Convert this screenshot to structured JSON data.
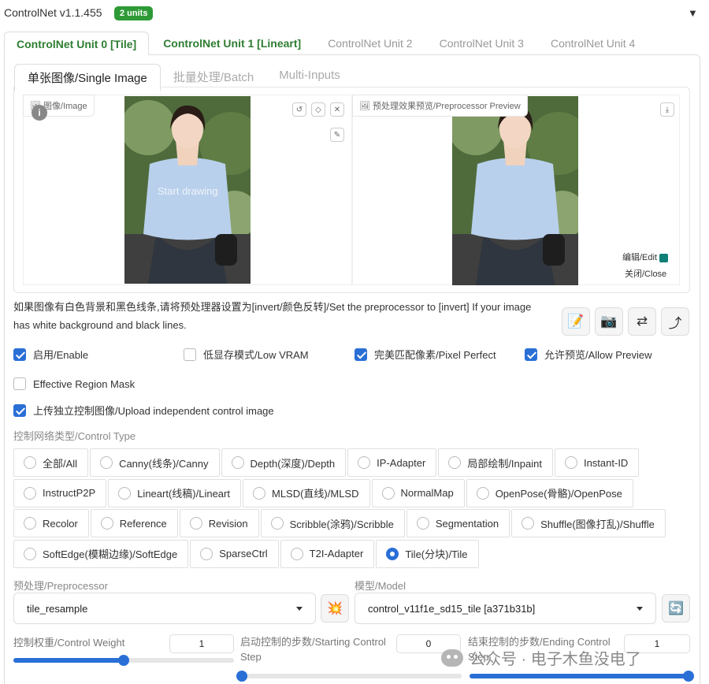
{
  "header": {
    "title": "ControlNet v1.1.455",
    "badge": "2 units",
    "collapse_icon": "▼"
  },
  "unit_tabs": [
    "ControlNet Unit 0 [Tile]",
    "ControlNet Unit 1 [Lineart]",
    "ControlNet Unit 2",
    "ControlNet Unit 3",
    "ControlNet Unit 4"
  ],
  "image_tabs": [
    "单张图像/Single Image",
    "批量处理/Batch",
    "Multi-Inputs"
  ],
  "image_panel": {
    "input_label": "图像/Image",
    "preview_label": "预处理效果预览/Preprocessor Preview",
    "start_drawing": "Start drawing",
    "edit_link": "编辑/Edit",
    "close_link": "关闭/Close",
    "info": "i"
  },
  "hint_text": "如果图像有白色背景和黑色线条,请将预处理器设置为[invert/颜色反转]/Set the preprocessor to [invert] If your image has white background and black lines.",
  "checkboxes": {
    "enable": {
      "label": "启用/Enable",
      "checked": true
    },
    "low_vram": {
      "label": "低显存模式/Low VRAM",
      "checked": false
    },
    "pixel_perfect": {
      "label": "完美匹配像素/Pixel Perfect",
      "checked": true
    },
    "allow_preview": {
      "label": "允许预览/Allow Preview",
      "checked": true
    },
    "region_mask": {
      "label": "Effective Region Mask",
      "checked": false
    },
    "upload_independent": {
      "label": "上传独立控制图像/Upload independent control image",
      "checked": true
    }
  },
  "control_type": {
    "label": "控制网络类型/Control Type",
    "rows": [
      [
        "全部/All",
        "Canny(线条)/Canny",
        "Depth(深度)/Depth",
        "IP-Adapter",
        "局部绘制/Inpaint",
        "Instant-ID"
      ],
      [
        "InstructP2P",
        "Lineart(线稿)/Lineart",
        "MLSD(直线)/MLSD",
        "NormalMap",
        "OpenPose(骨骼)/OpenPose"
      ],
      [
        "Recolor",
        "Reference",
        "Revision",
        "Scribble(涂鸦)/Scribble",
        "Segmentation",
        "Shuffle(图像打乱)/Shuffle"
      ],
      [
        "SoftEdge(模糊边缘)/SoftEdge",
        "SparseCtrl",
        "T2I-Adapter",
        "Tile(分块)/Tile"
      ]
    ],
    "selected": "Tile(分块)/Tile"
  },
  "preprocessor": {
    "label": "预处理/Preprocessor",
    "value": "tile_resample",
    "run_icon": "💥"
  },
  "model": {
    "label": "模型/Model",
    "value": "control_v11f1e_sd15_tile [a371b31b]",
    "refresh_icon": "🔄"
  },
  "sliders": {
    "weight": {
      "label": "控制权重/Control Weight",
      "value": "1",
      "fraction": 0.5
    },
    "start": {
      "label": "启动控制的步数/Starting Control Step",
      "value": "0",
      "fraction": 0.0
    },
    "end": {
      "label": "结束控制的步数/Ending Control Step",
      "value": "1",
      "fraction": 1.0
    }
  },
  "tools": {
    "edit_icon": "📝",
    "camera_icon": "📷",
    "swap_icon": "⇄",
    "send_icon": "⤴"
  },
  "watermark": "公众号 · 电子木鱼没电了"
}
